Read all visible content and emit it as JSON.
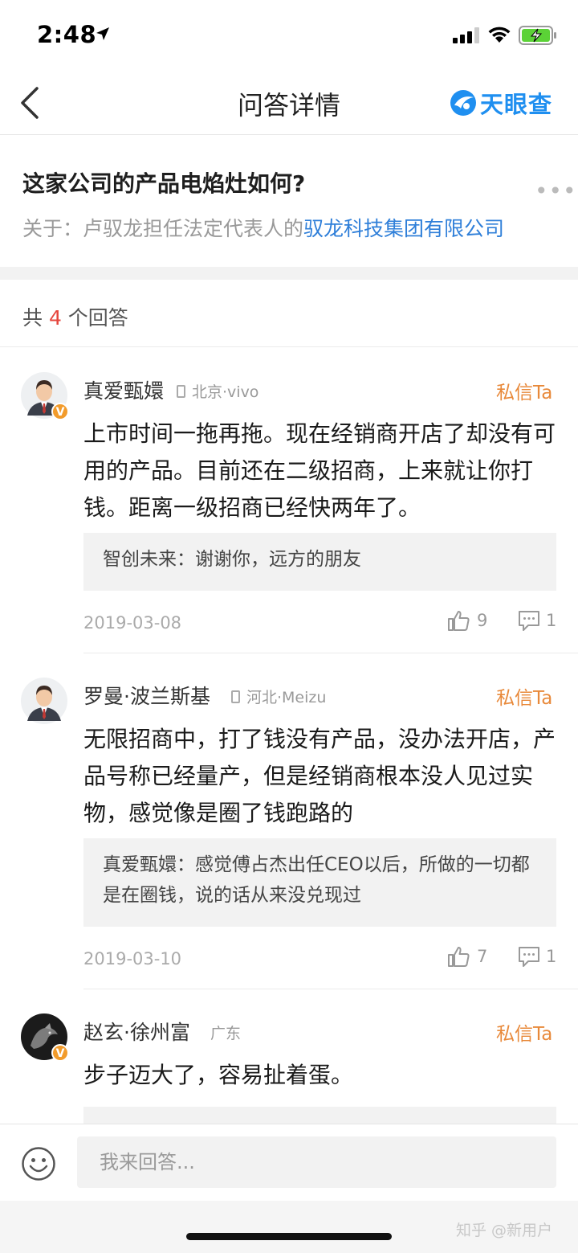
{
  "status_bar": {
    "time": "2:48"
  },
  "nav": {
    "title": "问答详情",
    "logo_text": "天眼查"
  },
  "question": {
    "title": "这家公司的产品电焰灶如何?",
    "about_prefix": "关于：卢驭龙担任法定代表人的",
    "about_company": "驭龙科技集团有限公司"
  },
  "answers_header": {
    "prefix": "共 ",
    "count": "4",
    "suffix": " 个回答"
  },
  "answers": [
    {
      "author": "真爱甄嬛",
      "meta": "北京·vivo",
      "pm_label": "私信Ta",
      "content": "上市时间一拖再拖。现在经销商开店了却没有可用的产品。目前还在二级招商，上来就让你打钱。距离一级招商已经快两年了。",
      "reply": "智创未来：谢谢你，远方的朋友",
      "date": "2019-03-08",
      "likes": "9",
      "comments": "1"
    },
    {
      "author": "罗曼·波兰斯基",
      "meta": "河北·Meizu",
      "pm_label": "私信Ta",
      "content": "无限招商中，打了钱没有产品，没办法开店，产品号称已经量产，但是经销商根本没人见过实物，感觉像是圈了钱跑路的",
      "reply": "真爱甄嬛：感觉傅占杰出任CEO以后，所做的一切都是在圈钱，说的话从来没兑现过",
      "date": "2019-03-10",
      "likes": "7",
      "comments": "1"
    },
    {
      "author": "赵玄·徐州富",
      "meta": "广东",
      "pm_label": "私信Ta",
      "content": "步子迈大了，容易扯着蛋。"
    }
  ],
  "bottom": {
    "input_placeholder": "我来回答..."
  },
  "watermark": "知乎 @新用户",
  "colors": {
    "accent_blue": "#2f7fd9",
    "count_red": "#e5453c",
    "pm_orange": "#e8893a",
    "badge_orange": "#f29b2b"
  }
}
